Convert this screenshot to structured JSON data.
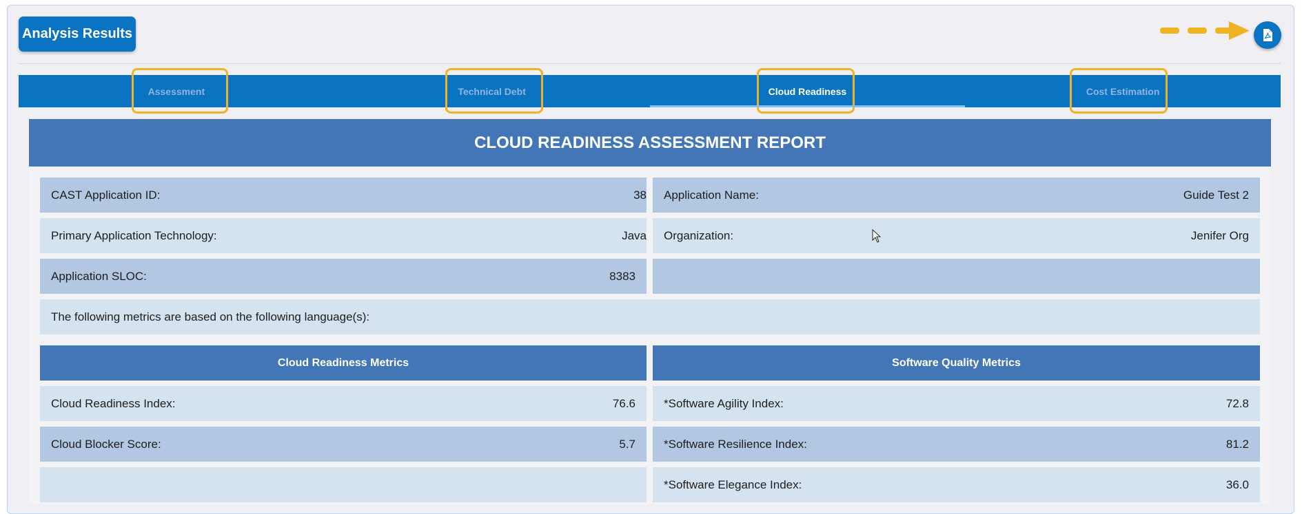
{
  "header": {
    "title": "Analysis Results",
    "pdf_icon": "pdf-file-icon",
    "arrow_color": "#f0b323"
  },
  "tabs": [
    {
      "label": "Assessment",
      "active": false
    },
    {
      "label": "Technical Debt",
      "active": false
    },
    {
      "label": "Cloud Readiness",
      "active": true
    },
    {
      "label": "Cost Estimation",
      "active": false
    }
  ],
  "report": {
    "title": "CLOUD READINESS ASSESSMENT REPORT",
    "info": {
      "app_id_label": "CAST Application ID:",
      "app_id_value": "38",
      "app_name_label": "Application Name:",
      "app_name_value": "Guide Test 2",
      "technology_label": "Primary Application Technology:",
      "technology_value": "Java",
      "org_label": "Organization:",
      "org_value": "Jenifer Org",
      "sloc_label": "Application SLOC:",
      "sloc_value": "8383"
    },
    "languages_text": "The following metrics are based on the following language(s):",
    "cloud_metrics": {
      "heading": "Cloud Readiness Metrics",
      "rows": [
        {
          "label": "Cloud Readiness Index:",
          "value": "76.6"
        },
        {
          "label": "Cloud Blocker Score:",
          "value": "5.7"
        }
      ]
    },
    "quality_metrics": {
      "heading": "Software Quality Metrics",
      "rows": [
        {
          "label": "*Software Agility Index:",
          "value": "72.8"
        },
        {
          "label": "*Software Resilience Index:",
          "value": "81.2"
        },
        {
          "label": "*Software Elegance Index:",
          "value": "36.0"
        }
      ]
    }
  },
  "colors": {
    "primary": "#0a73c2",
    "report_header": "#4376b6",
    "row_dark": "#b2c7e2",
    "row_light": "#d5e2f0",
    "highlight": "#f0b323"
  }
}
